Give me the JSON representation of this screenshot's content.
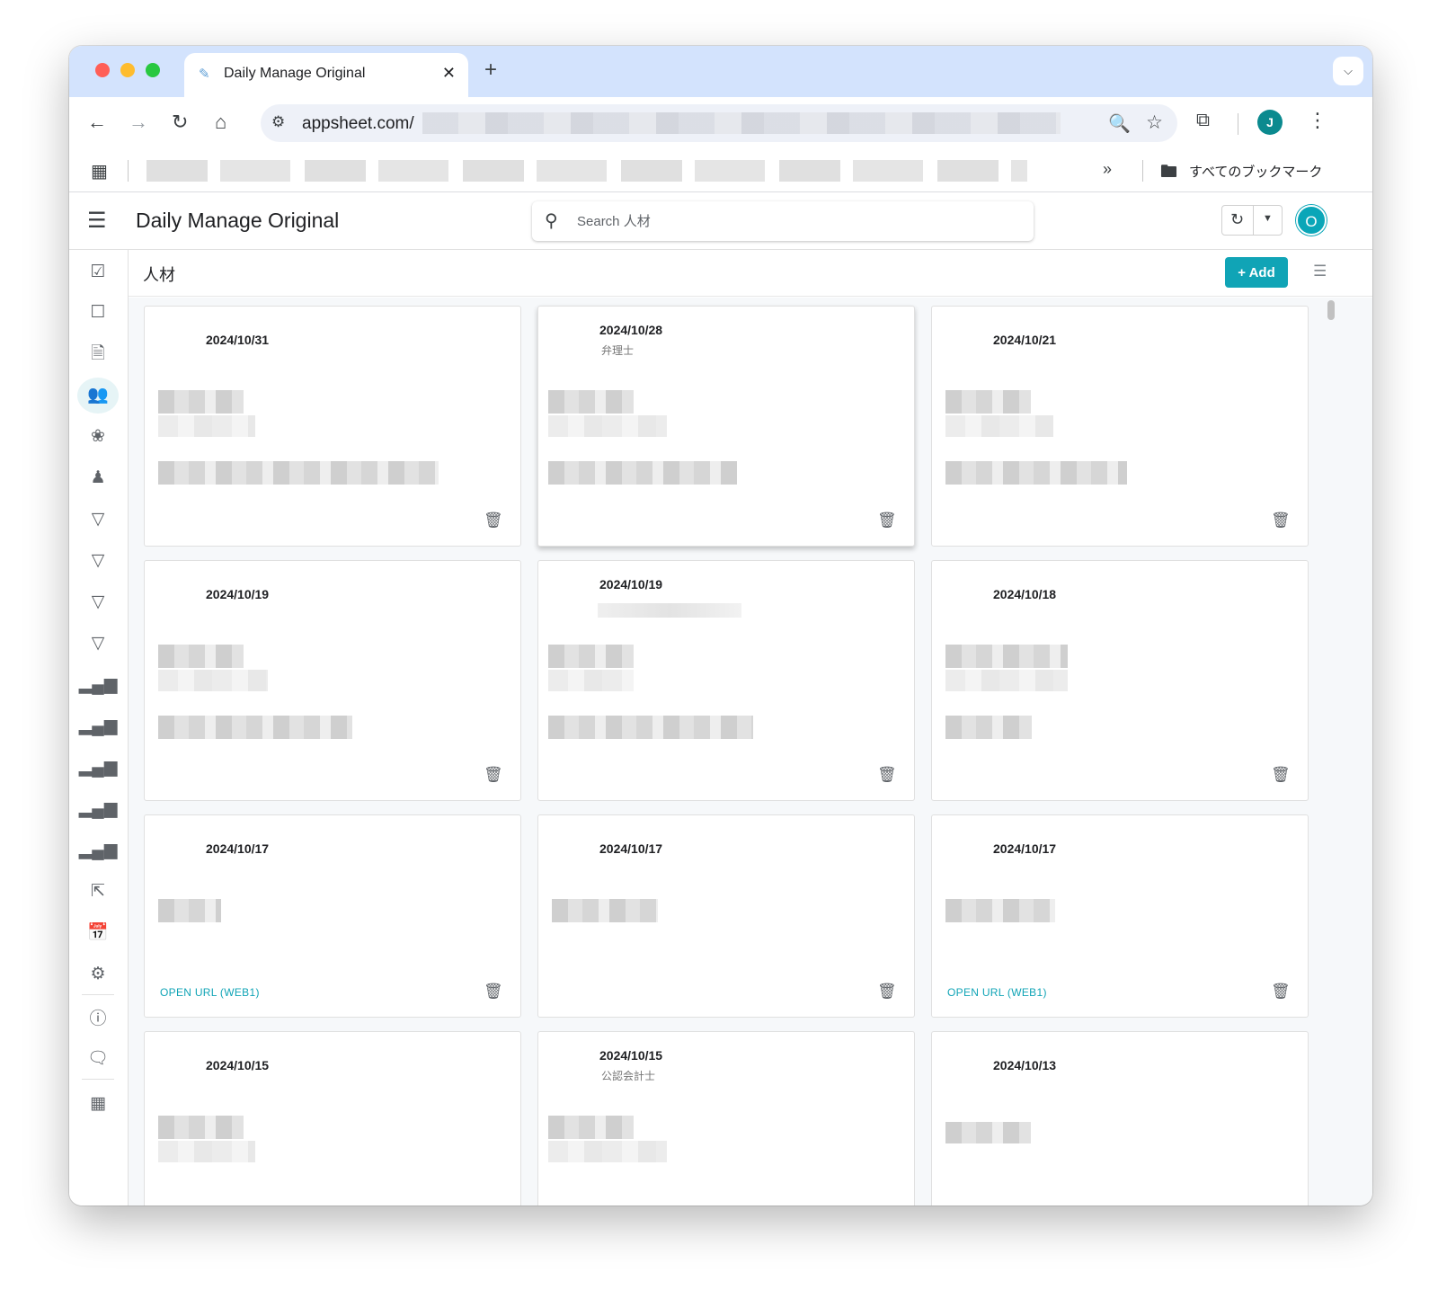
{
  "browser": {
    "tab_title": "Daily Manage Original",
    "tab_favicon": "notepad-icon",
    "url": "appsheet.com/",
    "profile_initial": "J",
    "bookmarks_all": "すべてのブックマーク"
  },
  "app": {
    "title": "Daily Manage Original",
    "search_placeholder": "Search 人材",
    "user_initial": "O",
    "accent_color": "#10a4b6"
  },
  "view": {
    "title": "人材",
    "add_label": "Add",
    "add_icon": "plus-icon"
  },
  "nav": [
    {
      "icon": "checkbox-checked-icon"
    },
    {
      "icon": "checkbox-empty-icon"
    },
    {
      "icon": "document-icon"
    },
    {
      "icon": "people-icon",
      "active": true
    },
    {
      "icon": "badge-icon"
    },
    {
      "icon": "person-desk-icon"
    },
    {
      "icon": "filter-icon"
    },
    {
      "icon": "filter-icon"
    },
    {
      "icon": "filter-icon"
    },
    {
      "icon": "filter-icon"
    },
    {
      "icon": "signal-bars-icon"
    },
    {
      "icon": "signal-bars-icon"
    },
    {
      "icon": "signal-bars-icon"
    },
    {
      "icon": "signal-bars-icon"
    },
    {
      "icon": "signal-bars-icon"
    },
    {
      "icon": "file-import-icon"
    },
    {
      "icon": "calendar-x-icon"
    },
    {
      "icon": "gear-icon"
    },
    {
      "icon": "info-icon"
    },
    {
      "icon": "feedback-icon"
    },
    {
      "icon": "apps-grid-icon"
    }
  ],
  "cards": [
    {
      "date": "2024/10/31",
      "subtitle": ""
    },
    {
      "date": "2024/10/28",
      "subtitle": "弁理士"
    },
    {
      "date": "2024/10/21",
      "subtitle": ""
    },
    {
      "date": "2024/10/19",
      "subtitle": ""
    },
    {
      "date": "2024/10/19",
      "subtitle": ""
    },
    {
      "date": "2024/10/18",
      "subtitle": ""
    },
    {
      "date": "2024/10/17",
      "subtitle": "",
      "link": "OPEN URL (WEB1)"
    },
    {
      "date": "2024/10/17",
      "subtitle": ""
    },
    {
      "date": "2024/10/17",
      "subtitle": "",
      "link": "OPEN URL (WEB1)"
    },
    {
      "date": "2024/10/15",
      "subtitle": ""
    },
    {
      "date": "2024/10/15",
      "subtitle": "公認会計士"
    },
    {
      "date": "2024/10/13",
      "subtitle": ""
    }
  ]
}
